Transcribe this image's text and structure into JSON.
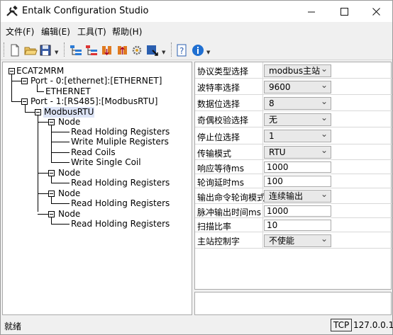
{
  "window": {
    "title": "Entalk Configuration Studio",
    "minimize": "—",
    "maximize": "☐",
    "close": "✕"
  },
  "menu": {
    "file": "文件(F)",
    "edit": "编辑(E)",
    "tools": "工具(T)",
    "help": "帮助(H)"
  },
  "tree": {
    "root": "ECAT2MRM",
    "port0": "Port - 0:[ethernet]:[ETHERNET]",
    "ethernet": "ETHERNET",
    "port1": "Port - 1:[RS485]:[ModbusRTU]",
    "modbus": "ModbusRTU",
    "node_label": "Node",
    "nodes": [
      {
        "label": "Node",
        "children": [
          "Read Holding Registers",
          "Write Muliple Registers",
          "Read Coils",
          "Write Single Coil"
        ]
      },
      {
        "label": "Node",
        "children": [
          "Read Holding Registers"
        ]
      },
      {
        "label": "Node",
        "children": [
          "Read Holding Registers"
        ]
      },
      {
        "label": "Node",
        "children": [
          "Read Holding Registers"
        ]
      }
    ]
  },
  "props": [
    {
      "label": "协议类型选择",
      "value": "modbus主站",
      "type": "combo"
    },
    {
      "label": "波特率选择",
      "value": "9600",
      "type": "combo"
    },
    {
      "label": "数据位选择",
      "value": "8",
      "type": "combo"
    },
    {
      "label": "奇偶校验选择",
      "value": "无",
      "type": "combo"
    },
    {
      "label": "停止位选择",
      "value": "1",
      "type": "combo"
    },
    {
      "label": "传输模式",
      "value": "RTU",
      "type": "combo"
    },
    {
      "label": "响应等待ms",
      "value": "1000",
      "type": "text"
    },
    {
      "label": "轮询延时ms",
      "value": "100",
      "type": "text"
    },
    {
      "label": "输出命令轮询模式",
      "value": "连续输出",
      "type": "combo"
    },
    {
      "label": "脉冲输出时间ms",
      "value": "1000",
      "type": "text"
    },
    {
      "label": "扫描比率",
      "value": "10",
      "type": "text"
    },
    {
      "label": "主站控制字",
      "value": "不使能",
      "type": "combo"
    }
  ],
  "status": {
    "text": "就绪",
    "protocol": "TCP",
    "ip": "127.0.0.1"
  },
  "colors": {
    "selection": "#dde4f6",
    "accent": "#1f6fd1"
  }
}
